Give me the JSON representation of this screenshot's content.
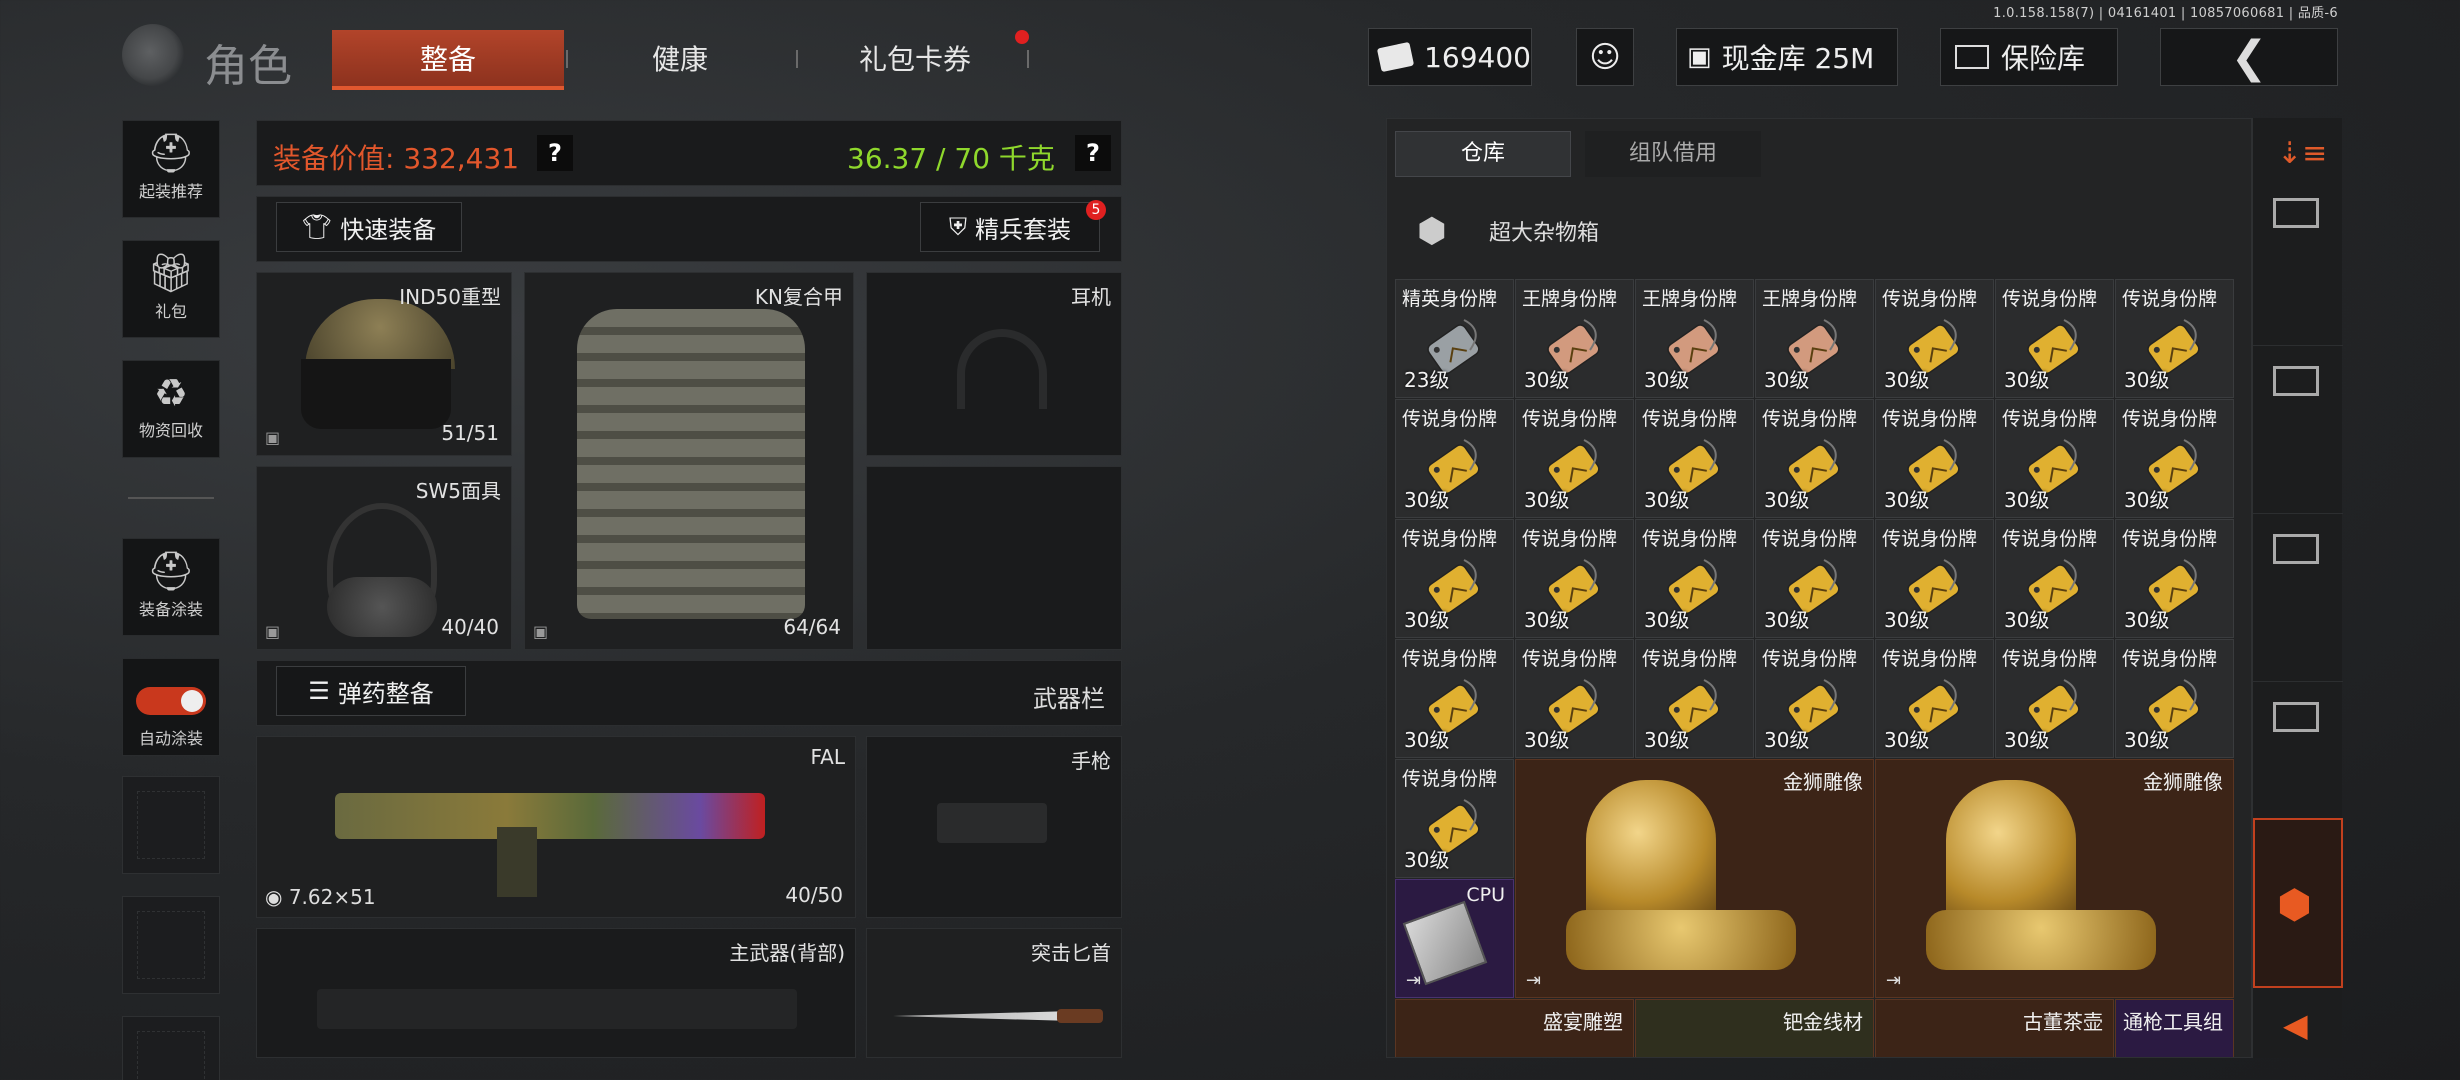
{
  "version": "1.0.158.158(7) | 04161401 | 10857060681 | 品质-6",
  "header": {
    "title": "角色",
    "tabs": [
      {
        "label": "整备",
        "active": true
      },
      {
        "label": "健康",
        "active": false
      },
      {
        "label": "礼包卡券",
        "active": false
      }
    ],
    "currency": "169400",
    "cash_vault": "现金库 25M",
    "safe": "保险库"
  },
  "sidebar": [
    {
      "label": "起装推荐",
      "icon": "helmet-gear-icon"
    },
    {
      "label": "礼包",
      "icon": "gift-icon"
    },
    {
      "label": "物资回收",
      "icon": "recycle-icon"
    },
    {
      "label": "装备涂装",
      "icon": "paint-helmet-icon"
    },
    {
      "label": "自动涂装",
      "icon": "toggle-icon"
    }
  ],
  "equip": {
    "value_label": "装备价值: 332,431",
    "weight": "36.37 / 70 千克",
    "help": "?",
    "quick_equip": "快速装备",
    "elite_set": "精兵套装",
    "elite_badge": "5",
    "slots": {
      "helmet": {
        "name": "IND50重型",
        "dur": "51/51"
      },
      "armor": {
        "name": "KN复合甲",
        "dur": "64/64"
      },
      "headset": {
        "name": "耳机"
      },
      "mask": {
        "name": "SW5面具",
        "dur": "40/40"
      }
    },
    "ammo_btn": "弹药整备",
    "weapon_bar": "武器栏",
    "primary": {
      "name": "FAL",
      "ammo": "7.62×51",
      "mag": "40/50"
    },
    "pistol": "手枪",
    "backup": "主武器(背部)",
    "knife": "突击匕首"
  },
  "storage": {
    "tabs": [
      "仓库",
      "组队借用"
    ],
    "container": "超大杂物箱",
    "rows": [
      [
        {
          "n": "精英身份牌",
          "l": "23级",
          "c": "#9aa0a4"
        },
        {
          "n": "王牌身份牌",
          "l": "30级",
          "c": "#d29a7e"
        },
        {
          "n": "王牌身份牌",
          "l": "30级",
          "c": "#d29a7e"
        },
        {
          "n": "王牌身份牌",
          "l": "30级",
          "c": "#d29a7e"
        },
        {
          "n": "传说身份牌",
          "l": "30级",
          "c": "#e0b030"
        },
        {
          "n": "传说身份牌",
          "l": "30级",
          "c": "#e0b030"
        },
        {
          "n": "传说身份牌",
          "l": "30级",
          "c": "#e0b030"
        }
      ],
      [
        {
          "n": "传说身份牌",
          "l": "30级",
          "c": "#e0b030"
        },
        {
          "n": "传说身份牌",
          "l": "30级",
          "c": "#e0b030"
        },
        {
          "n": "传说身份牌",
          "l": "30级",
          "c": "#e0b030"
        },
        {
          "n": "传说身份牌",
          "l": "30级",
          "c": "#e0b030"
        },
        {
          "n": "传说身份牌",
          "l": "30级",
          "c": "#e0b030"
        },
        {
          "n": "传说身份牌",
          "l": "30级",
          "c": "#e0b030"
        },
        {
          "n": "传说身份牌",
          "l": "30级",
          "c": "#e0b030"
        }
      ],
      [
        {
          "n": "传说身份牌",
          "l": "30级",
          "c": "#e0b030"
        },
        {
          "n": "传说身份牌",
          "l": "30级",
          "c": "#e0b030"
        },
        {
          "n": "传说身份牌",
          "l": "30级",
          "c": "#e0b030"
        },
        {
          "n": "传说身份牌",
          "l": "30级",
          "c": "#e0b030"
        },
        {
          "n": "传说身份牌",
          "l": "30级",
          "c": "#e0b030"
        },
        {
          "n": "传说身份牌",
          "l": "30级",
          "c": "#e0b030"
        },
        {
          "n": "传说身份牌",
          "l": "30级",
          "c": "#e0b030"
        }
      ],
      [
        {
          "n": "传说身份牌",
          "l": "30级",
          "c": "#e0b030"
        },
        {
          "n": "传说身份牌",
          "l": "30级",
          "c": "#e0b030"
        },
        {
          "n": "传说身份牌",
          "l": "30级",
          "c": "#e0b030"
        },
        {
          "n": "传说身份牌",
          "l": "30级",
          "c": "#e0b030"
        },
        {
          "n": "传说身份牌",
          "l": "30级",
          "c": "#e0b030"
        },
        {
          "n": "传说身份牌",
          "l": "30级",
          "c": "#e0b030"
        },
        {
          "n": "传说身份牌",
          "l": "30级",
          "c": "#e0b030"
        }
      ]
    ],
    "row5_tag": {
      "n": "传说身份牌",
      "l": "30级",
      "c": "#e0b030"
    },
    "lion1": "金狮雕像",
    "lion2": "金狮雕像",
    "cpu": "CPU",
    "bottom": [
      "盛宴雕塑",
      "钯金线材",
      "古董茶壶",
      "通枪工具组"
    ]
  }
}
